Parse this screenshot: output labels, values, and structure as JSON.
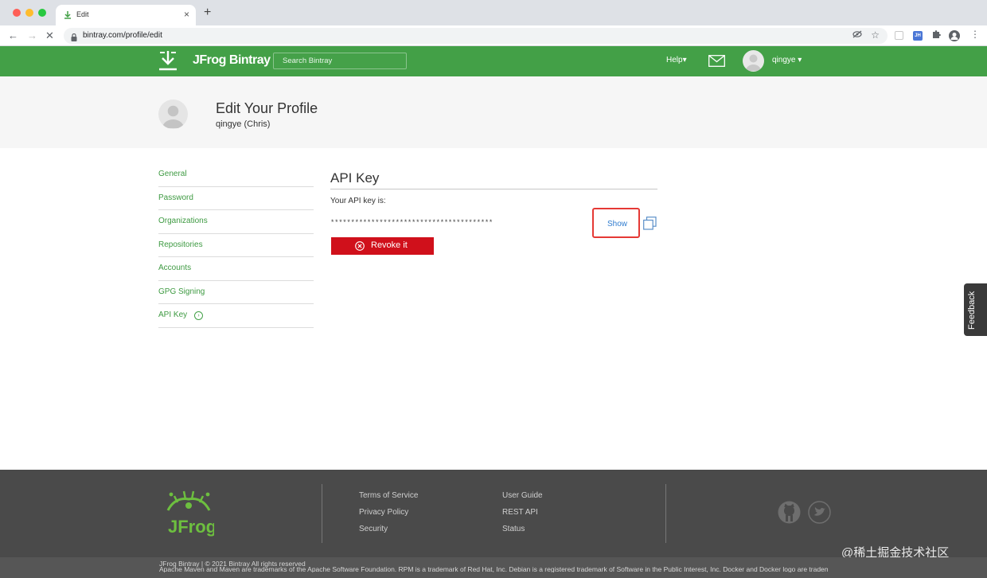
{
  "browser": {
    "tab_title": "Edit",
    "tab_close": "×",
    "new_tab": "+",
    "back": "←",
    "forward": "→",
    "stop": "✕",
    "url": "bintray.com/profile/edit",
    "ext_badge": "JH"
  },
  "header": {
    "brand": "JFrog Bintray",
    "search_placeholder": "Search Bintray",
    "help_label": "Help▾",
    "user_label": "qingye ▾"
  },
  "profile": {
    "title": "Edit Your Profile",
    "subtitle": "qingye (Chris)"
  },
  "side_menu": {
    "items": [
      {
        "label": "General"
      },
      {
        "label": "Password"
      },
      {
        "label": "Organizations"
      },
      {
        "label": "Repositories"
      },
      {
        "label": "Accounts"
      },
      {
        "label": "GPG Signing"
      },
      {
        "label": "API Key",
        "active": true
      }
    ],
    "active_arrow": "›"
  },
  "api_key": {
    "title": "API Key",
    "label": "Your API key is:",
    "masked": "****************************************",
    "show_label": "Show",
    "revoke_label": "Revoke it"
  },
  "feedback": {
    "label": "Feedback"
  },
  "footer": {
    "links_col1": [
      "Terms of Service",
      "Privacy Policy",
      "Security"
    ],
    "links_col2": [
      "User Guide",
      "REST API",
      "Status"
    ],
    "copyright": "JFrog Bintray | © 2021 Bintray All rights reserved",
    "trademark": "Apache Maven and Maven are trademarks of the Apache Software Foundation. RPM is a trademark of Red Hat, Inc. Debian is a registered trademark of Software in the Public Interest, Inc. Docker and Docker logo are trademarks or registered trademarks of Docker, Inc. in the United States and/or other countries. Docker, Inc. and other parties may also have trademark rights in other terms used herein.",
    "watermark": "@稀土掘金技术社区",
    "logo_text": "JFrog"
  },
  "colors": {
    "brand_green": "#43a047",
    "revoke_red": "#d0101b",
    "highlight_red": "#e53935",
    "link_blue": "#2f7ccf",
    "footer_bg": "#4a4a4a"
  }
}
